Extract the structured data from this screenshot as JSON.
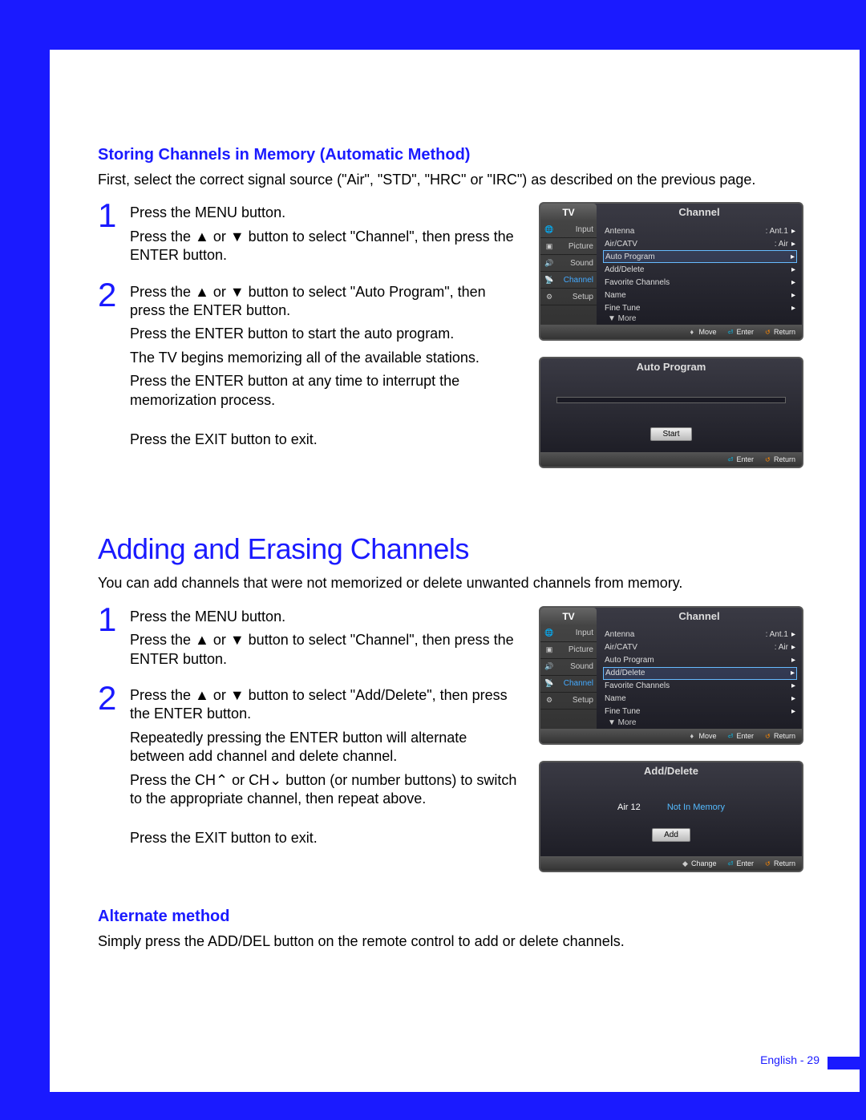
{
  "section1": {
    "heading": "Storing Channels in Memory (Automatic Method)",
    "intro": "First, select the correct signal source (\"Air\", \"STD\", \"HRC\" or \"IRC\") as described on the previous page.",
    "steps": [
      {
        "num": "1",
        "lines": [
          "Press the MENU button.",
          "Press the ▲ or ▼ button to select \"Channel\", then press the ENTER button."
        ]
      },
      {
        "num": "2",
        "lines": [
          "Press the ▲ or ▼ button to select \"Auto Program\", then press the ENTER button.",
          "Press the ENTER button to start the auto program.",
          "The TV begins memorizing all of the available stations.",
          "Press the ENTER button at any time to interrupt the memorization process.",
          "",
          "Press the EXIT button to exit."
        ]
      }
    ]
  },
  "section2": {
    "heading": "Adding and Erasing Channels",
    "intro": "You can add channels that were not memorized or delete unwanted channels from memory.",
    "steps": [
      {
        "num": "1",
        "lines": [
          "Press the MENU button.",
          "Press the ▲ or ▼ button to select \"Channel\", then press the ENTER button."
        ]
      },
      {
        "num": "2",
        "lines": [
          "Press the ▲ or ▼ button to select \"Add/Delete\", then press the ENTER button.",
          "Repeatedly pressing the ENTER button will alternate between add channel and delete channel.",
          "Press the CH⌃ or CH⌄ button (or number buttons) to switch to the appropriate channel, then repeat above.",
          "",
          "Press the EXIT button to exit."
        ]
      }
    ]
  },
  "section3": {
    "heading": "Alternate method",
    "intro": "Simply press the ADD/DEL button on the remote control to add or delete channels."
  },
  "osd_common": {
    "tv_tab": "TV",
    "title": "Channel",
    "sidebar": [
      "Input",
      "Picture",
      "Sound",
      "Channel",
      "Setup"
    ],
    "rows": [
      {
        "label": "Antenna",
        "val": ": Ant.1"
      },
      {
        "label": "Air/CATV",
        "val": ": Air"
      },
      {
        "label": "Auto Program",
        "val": ""
      },
      {
        "label": "Add/Delete",
        "val": ""
      },
      {
        "label": "Favorite Channels",
        "val": ""
      },
      {
        "label": "Name",
        "val": ""
      },
      {
        "label": "Fine Tune",
        "val": ""
      }
    ],
    "more": "▼ More",
    "footer": {
      "move": "Move",
      "enter": "Enter",
      "return": "Return",
      "change": "Change"
    }
  },
  "osd_autoprogram": {
    "title": "Auto Program",
    "button": "Start"
  },
  "osd_adddelete": {
    "title": "Add/Delete",
    "channel_label": "Air 12",
    "status": "Not In Memory",
    "button": "Add"
  },
  "page_footer": "English - 29"
}
